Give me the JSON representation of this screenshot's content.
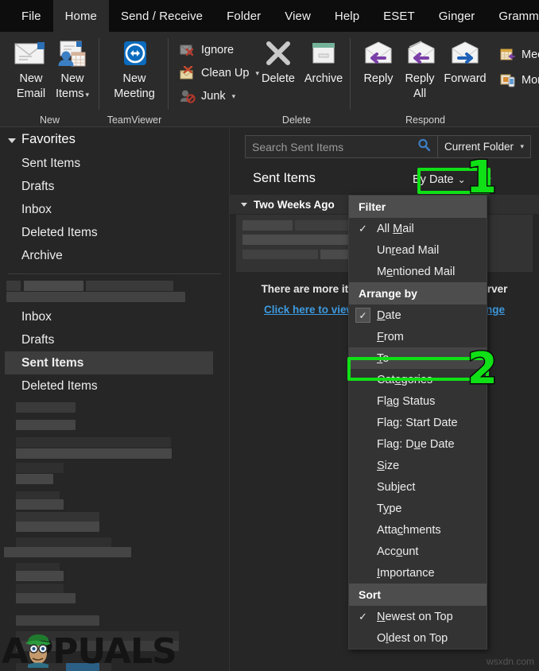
{
  "window": {
    "theme_bg": "#262626",
    "accent_green": "#10e016"
  },
  "ribbon_tabs": [
    {
      "label": "File",
      "active": false
    },
    {
      "label": "Home",
      "active": true
    },
    {
      "label": "Send / Receive",
      "active": false
    },
    {
      "label": "Folder",
      "active": false
    },
    {
      "label": "View",
      "active": false
    },
    {
      "label": "Help",
      "active": false
    },
    {
      "label": "ESET",
      "active": false
    },
    {
      "label": "Ginger",
      "active": false
    },
    {
      "label": "Grammarly",
      "active": false
    }
  ],
  "ribbon_groups": [
    {
      "name": "New",
      "label": "New",
      "buttons": [
        {
          "label_line1": "New",
          "label_line2": "Email",
          "icon": "new-email-icon",
          "has_caret": false
        },
        {
          "label_line1": "New",
          "label_line2": "Items",
          "icon": "new-items-icon",
          "has_caret": true
        }
      ]
    },
    {
      "name": "TeamViewer",
      "label": "TeamViewer",
      "buttons": [
        {
          "label_line1": "New",
          "label_line2": "Meeting",
          "icon": "teamviewer-icon",
          "has_caret": false
        }
      ]
    },
    {
      "name": "Delete",
      "label": "Delete",
      "small_buttons": [
        {
          "label": "Ignore",
          "icon": "ignore-icon",
          "has_caret": false
        },
        {
          "label": "Clean Up",
          "icon": "cleanup-icon",
          "has_caret": true
        },
        {
          "label": "Junk",
          "icon": "junk-icon",
          "has_caret": true
        }
      ],
      "buttons": [
        {
          "label_line1": "Delete",
          "label_line2": "",
          "icon": "delete-x-icon",
          "has_caret": false
        },
        {
          "label_line1": "Archive",
          "label_line2": "",
          "icon": "archive-icon",
          "has_caret": false
        }
      ]
    },
    {
      "name": "Respond",
      "label": "Respond",
      "buttons": [
        {
          "label_line1": "Reply",
          "label_line2": "",
          "icon": "reply-icon",
          "has_caret": false
        },
        {
          "label_line1": "Reply",
          "label_line2": "All",
          "icon": "reply-all-icon",
          "has_caret": false
        },
        {
          "label_line1": "Forward",
          "label_line2": "",
          "icon": "forward-icon",
          "has_caret": false
        }
      ],
      "small_buttons": [
        {
          "label": "Mee",
          "icon": "meeting-icon",
          "has_caret": false
        },
        {
          "label": "Mor",
          "icon": "more-icon",
          "has_caret": false
        }
      ]
    }
  ],
  "sidebar": {
    "favorites_label": "Favorites",
    "collapse_icon": "chevron-left-icon",
    "favorites": [
      {
        "label": "Sent Items"
      },
      {
        "label": "Drafts"
      },
      {
        "label": "Inbox"
      },
      {
        "label": "Deleted Items"
      },
      {
        "label": "Archive"
      }
    ],
    "account_items": [
      {
        "label": "Inbox",
        "selected": false
      },
      {
        "label": "Drafts",
        "selected": false
      },
      {
        "label": "Sent Items",
        "selected": true
      },
      {
        "label": "Deleted Items",
        "selected": false
      }
    ]
  },
  "search": {
    "placeholder": "Search Sent Items",
    "value": "",
    "icon": "search-icon",
    "scope_label": "Current Folder",
    "scope_caret": "chevron-down-icon"
  },
  "message_list": {
    "folder_title": "Sent Items",
    "sort_label": "By Date",
    "sort_caret": "chevron-down-icon",
    "sort_direction_icon": "arrow-up-icon",
    "group_header": "Two Weeks Ago",
    "more_items_text": "There are more items in this folder on the server",
    "more_items_link": "Click here to view more on Microsoft Exchange"
  },
  "dropdown_menu": {
    "sections": [
      {
        "header": "Filter",
        "items": [
          {
            "label": "All Mail",
            "accel_index": 4,
            "checked": true,
            "check_style": "tick",
            "highlighted": false
          },
          {
            "label": "Unread Mail",
            "accel_index": 3,
            "checked": false,
            "check_style": "none",
            "highlighted": false
          },
          {
            "label": "Mentioned Mail",
            "accel_index": 1,
            "checked": false,
            "check_style": "none",
            "highlighted": false
          }
        ]
      },
      {
        "header": "Arrange by",
        "items": [
          {
            "label": "Date",
            "accel_index": 0,
            "checked": true,
            "check_style": "box",
            "highlighted": false
          },
          {
            "label": "From",
            "accel_index": 0,
            "checked": false,
            "check_style": "none",
            "highlighted": false
          },
          {
            "label": "To",
            "accel_index": 0,
            "checked": false,
            "check_style": "none",
            "highlighted": true
          },
          {
            "label": "Categories",
            "accel_index": 4,
            "checked": false,
            "check_style": "none",
            "highlighted": false
          },
          {
            "label": "Flag Status",
            "accel_index": 2,
            "checked": false,
            "check_style": "none",
            "highlighted": false
          },
          {
            "label": "Flag: Start Date",
            "accel_index": 3,
            "checked": false,
            "check_style": "none",
            "highlighted": false
          },
          {
            "label": "Flag: Due Date",
            "accel_index": 7,
            "checked": false,
            "check_style": "none",
            "highlighted": false
          },
          {
            "label": "Size",
            "accel_index": 0,
            "checked": false,
            "check_style": "none",
            "highlighted": false
          },
          {
            "label": "Subject",
            "accel_index": 2,
            "checked": false,
            "check_style": "none",
            "highlighted": false
          },
          {
            "label": "Type",
            "accel_index": 1,
            "checked": false,
            "check_style": "none",
            "highlighted": false
          },
          {
            "label": "Attachments",
            "accel_index": 5,
            "checked": false,
            "check_style": "none",
            "highlighted": false
          },
          {
            "label": "Account",
            "accel_index": 4,
            "checked": false,
            "check_style": "none",
            "highlighted": false
          },
          {
            "label": "Importance",
            "accel_index": 0,
            "checked": false,
            "check_style": "none",
            "highlighted": false
          }
        ]
      },
      {
        "header": "Sort",
        "items": [
          {
            "label": "Newest on Top",
            "accel_index": 0,
            "checked": true,
            "check_style": "tick",
            "highlighted": false
          },
          {
            "label": "Oldest on Top",
            "accel_index": 1,
            "checked": false,
            "check_style": "none",
            "highlighted": false
          }
        ]
      }
    ]
  },
  "annotations": [
    {
      "number": "1",
      "target": "sort-by-date-button"
    },
    {
      "number": "2",
      "target": "menu-item-to"
    }
  ],
  "watermarks": {
    "brand": "APPUALS",
    "site": "wsxdn.com"
  }
}
